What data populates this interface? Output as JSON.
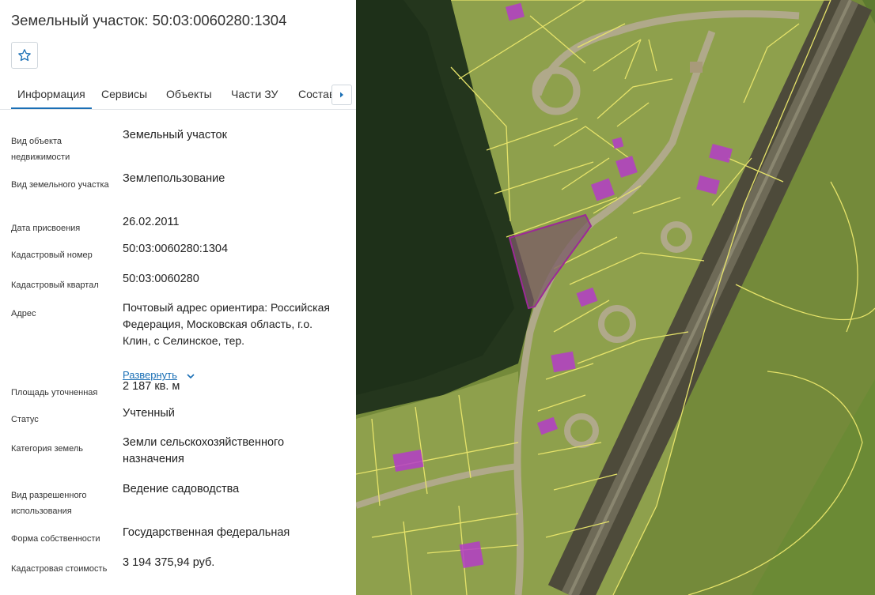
{
  "header": {
    "title": "Земельный участок: 50:03:0060280:1304",
    "favorite_icon": "star-outline-icon"
  },
  "tabs": [
    {
      "label": "Информация",
      "active": true
    },
    {
      "label": "Сервисы"
    },
    {
      "label": "Объекты"
    },
    {
      "label": "Части ЗУ"
    },
    {
      "label": "Состав"
    }
  ],
  "tabs_scroll_icon": "arrow-right-icon",
  "properties": [
    {
      "label": "Вид объекта недвижимости",
      "value": "Земельный участок"
    },
    {
      "label": "Вид земельного участка",
      "value": "Землепользование"
    },
    {
      "label": "Дата присвоения",
      "value": "26.02.2011"
    },
    {
      "label": "Кадастровый номер",
      "value": "50:03:0060280:1304"
    },
    {
      "label": "Кадастровый квартал",
      "value": "50:03:0060280"
    },
    {
      "label": "Адрес",
      "value": "Почтовый адрес ориентира: Российская Федерация, Московская область, г.о. Клин, с Селинское, тер."
    },
    {
      "label": "Площадь уточненная",
      "value": "2 187 кв. м"
    },
    {
      "label": "Статус",
      "value": "Учтенный"
    },
    {
      "label": "Категория земель",
      "value": "Земли сельскохозяйственного назначения"
    },
    {
      "label": "Вид разрешенного использования",
      "value": "Ведение садоводства"
    },
    {
      "label": "Форма собственности",
      "value": "Государственная федеральная"
    },
    {
      "label": "Кадастровая стоимость",
      "value": "3 194 375,94 руб."
    }
  ],
  "address_expand": {
    "label": "Развернуть",
    "icon": "chevron-down-icon"
  },
  "colors": {
    "accent": "#1a6fb5",
    "parcel_outline": "#e6e36a",
    "selected_parcel": "#9c2a96",
    "building_fill": "#b43cc8"
  }
}
